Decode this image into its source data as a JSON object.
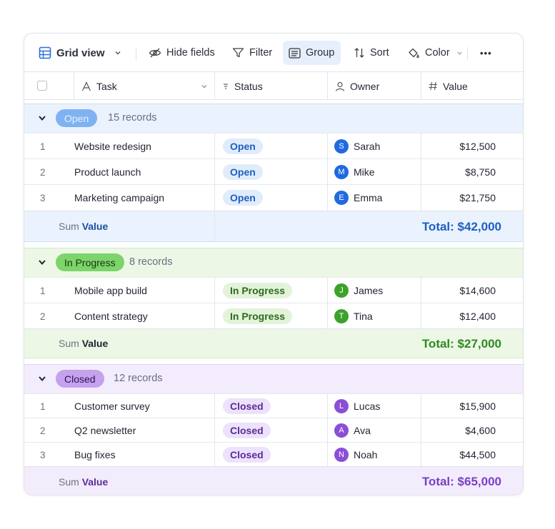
{
  "toolbar": {
    "grid_view": "Grid view",
    "hide_fields": "Hide fields",
    "filter": "Filter",
    "group": "Group",
    "sort": "Sort",
    "color": "Color",
    "more": "•••"
  },
  "columns": {
    "task": "Task",
    "status": "Status",
    "owner": "Owner",
    "value": "Value"
  },
  "colors": {
    "open_accent": "#1d5fc4",
    "progress_accent": "#2f8a1f",
    "closed_accent": "#7a3fc6"
  },
  "groups": [
    {
      "label": "Open",
      "count": "15 records",
      "rows": [
        {
          "num": "1",
          "task": "Website redesign",
          "status": "Open",
          "avatar": "S",
          "owner": "Sarah",
          "value": "$12,500"
        },
        {
          "num": "2",
          "task": "Product launch",
          "status": "Open",
          "avatar": "M",
          "owner": "Mike",
          "value": "$8,750"
        },
        {
          "num": "3",
          "task": "Marketing campaign",
          "status": "Open",
          "avatar": "E",
          "owner": "Emma",
          "value": "$21,750"
        }
      ],
      "sum_label": "Sum",
      "sum_field": "Value",
      "total": "Total: $42,000"
    },
    {
      "label": "In Progress",
      "count": "8 records",
      "rows": [
        {
          "num": "1",
          "task": "Mobile app build",
          "status": "In Progress",
          "avatar": "J",
          "owner": "James",
          "value": "$14,600"
        },
        {
          "num": "2",
          "task": "Content strategy",
          "status": "In Progress",
          "avatar": "T",
          "owner": "Tina",
          "value": "$12,400"
        }
      ],
      "sum_label": "Sum",
      "sum_field": "Value",
      "total": "Total: $27,000"
    },
    {
      "label": "Closed",
      "count": "12 records",
      "rows": [
        {
          "num": "1",
          "task": "Customer survey",
          "status": "Closed",
          "avatar": "L",
          "owner": "Lucas",
          "value": "$15,900"
        },
        {
          "num": "2",
          "task": "Q2 newsletter",
          "status": "Closed",
          "avatar": "A",
          "owner": "Ava",
          "value": "$4,600"
        },
        {
          "num": "3",
          "task": "Bug fixes",
          "status": "Closed",
          "avatar": "N",
          "owner": "Noah",
          "value": "$44,500"
        }
      ],
      "sum_label": "Sum",
      "sum_field": "Value",
      "total": "Total: $65,000"
    }
  ]
}
